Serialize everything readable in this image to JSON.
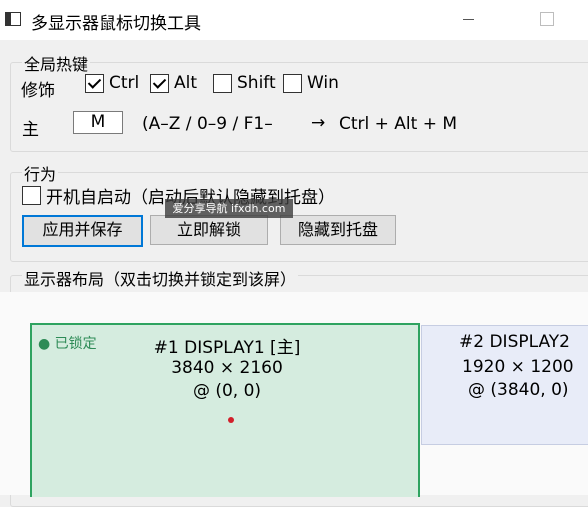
{
  "window": {
    "title": "多显示器鼠标切换工具"
  },
  "hotkey_group": {
    "title": "全局热键",
    "modifier_label": "修饰",
    "modifiers": [
      {
        "label": "Ctrl",
        "checked": true
      },
      {
        "label": "Alt",
        "checked": true
      },
      {
        "label": "Shift",
        "checked": false
      },
      {
        "label": "Win",
        "checked": false
      }
    ],
    "main_key_label": "主",
    "main_key_value": "M",
    "hint": "(A–Z / 0–9 / F1–",
    "arrow": "→",
    "combo": "Ctrl + Alt + M"
  },
  "behavior_group": {
    "title": "行为",
    "autostart_label": "开机自启动（启动后默认隐藏到托盘）",
    "autostart_checked": false,
    "buttons": {
      "apply_save": "应用并保存",
      "unlock": "立即解锁",
      "hide_tray": "隐藏到托盘"
    }
  },
  "layout_group": {
    "title": "显示器布局（双击切换并锁定到该屏）",
    "displays": [
      {
        "locked_badge": "● 已锁定",
        "name": "#1  DISPLAY1  [主]",
        "resolution": "3840 × 2160",
        "origin": "@ (0, 0)"
      },
      {
        "name": "#2  DISPLAY2",
        "resolution": "1920 × 1200",
        "origin": "@ (3840, 0)"
      }
    ]
  },
  "watermark": "爱分享导航 ifxdh.com"
}
